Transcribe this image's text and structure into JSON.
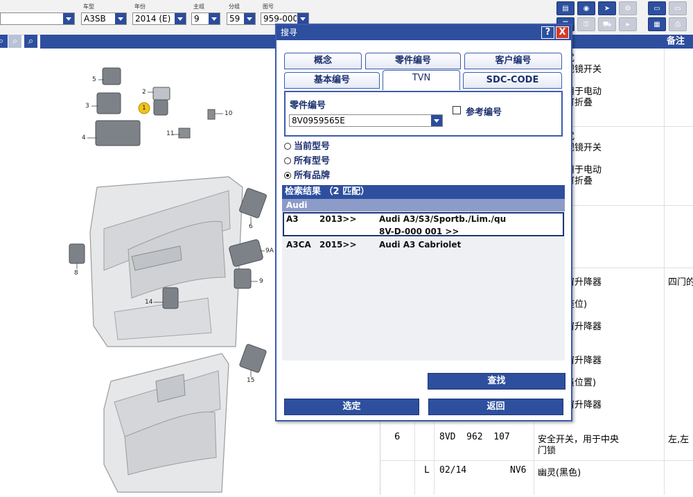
{
  "toolbar": {
    "fields": [
      {
        "label": "",
        "value": ""
      },
      {
        "label": "车型",
        "value": "A3SB"
      },
      {
        "label": "年份",
        "value": "2014 (E)"
      },
      {
        "label": "主组",
        "value": "9"
      },
      {
        "label": "分组",
        "value": "59"
      },
      {
        "label": "图号",
        "value": "959-000"
      }
    ]
  },
  "diagram": {
    "callouts": [
      "5",
      "2",
      "1",
      "3",
      "10",
      "4",
      "11",
      "8",
      "6",
      "9A",
      "9",
      "14",
      "15"
    ]
  },
  "parts_table": {
    "headers": {
      "remark": "备注"
    },
    "rows_desc": [
      "式",
      "视镜开关",
      "用于电动",
      "可折叠",
      "式",
      "视镜开关",
      "用于电动",
      "可折叠",
      "窗升降器",
      "座位)",
      "窗升降器",
      "窗升降器",
      "员位置)",
      "窗升降器"
    ],
    "remark_1": "四门的",
    "row_6": {
      "pos": "6",
      "part": "8VD  962  107",
      "desc": "安全开关，用于中央",
      "desc2": "门锁",
      "remark": "左,左"
    },
    "row_L": {
      "L": "L",
      "date": "02/14",
      "code": "NV6",
      "desc": "幽灵(黑色)"
    }
  },
  "dialog": {
    "title": "搜寻",
    "help": "?",
    "close": "X",
    "tabs_row1": [
      "概念",
      "零件编号",
      "客户编号"
    ],
    "tabs_row2": [
      "基本编号",
      "TVN",
      "SDC-CODE"
    ],
    "field_label": "零件编号",
    "field_value": "8V0959565E",
    "ref_checkbox": "参考编号",
    "radios": [
      "当前型号",
      "所有型号",
      "所有品牌"
    ],
    "results_header": "检索结果 （2 匹配）",
    "brand_group": "Audi",
    "results": [
      {
        "code": "A3",
        "year": "2013>>",
        "desc": "Audi A3/S3/Sportb./Lim./qu",
        "desc2": "8V-D-000 001 >>"
      },
      {
        "code": "A3CA",
        "year": "2015>>",
        "desc": "Audi A3 Cabriolet",
        "desc2": ""
      }
    ],
    "search_button": "查找",
    "select_button": "选定",
    "back_button": "返回"
  }
}
